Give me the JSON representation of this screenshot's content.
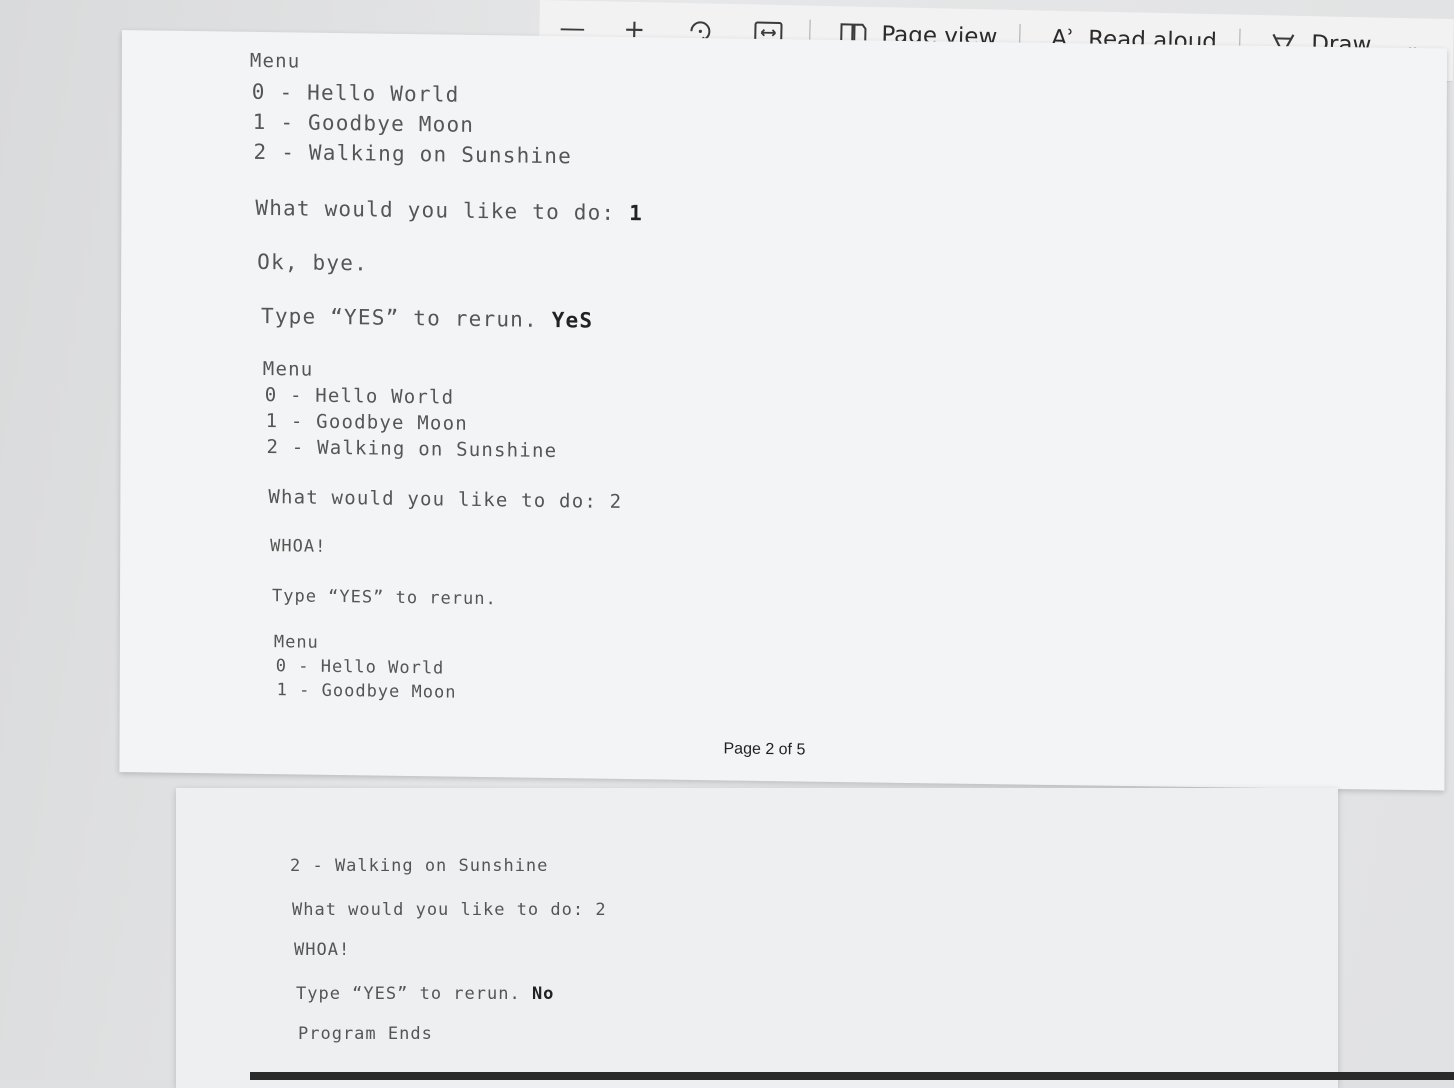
{
  "toolbar": {
    "zoom_out": "—",
    "zoom_in": "+",
    "page_view_label": "Page view",
    "read_aloud_label": "Read aloud",
    "draw_label": "Draw",
    "read_aloud_icon": "Aʾ"
  },
  "page1": {
    "lines": [
      "Menu",
      "0 - Hello World",
      "1 - Goodbye Moon",
      "2 - Walking on Sunshine",
      "What would you like to do: ",
      "1",
      "Ok, bye.",
      "Type “YES” to rerun. ",
      "YeS",
      "Menu",
      "0 - Hello World",
      "1 - Goodbye Moon",
      "2 - Walking on Sunshine",
      "What would you like to do: 2",
      "WHOA!",
      "Type “YES” to rerun.",
      "Menu",
      "0 - Hello World",
      "1 - Goodbye Moon"
    ],
    "page_number": "Page 2 of 5"
  },
  "page2": {
    "lines": [
      "2 - Walking on Sunshine",
      "What would you like to do: 2",
      "WHOA!",
      "Type “YES” to rerun. ",
      "No",
      "Program Ends"
    ]
  }
}
